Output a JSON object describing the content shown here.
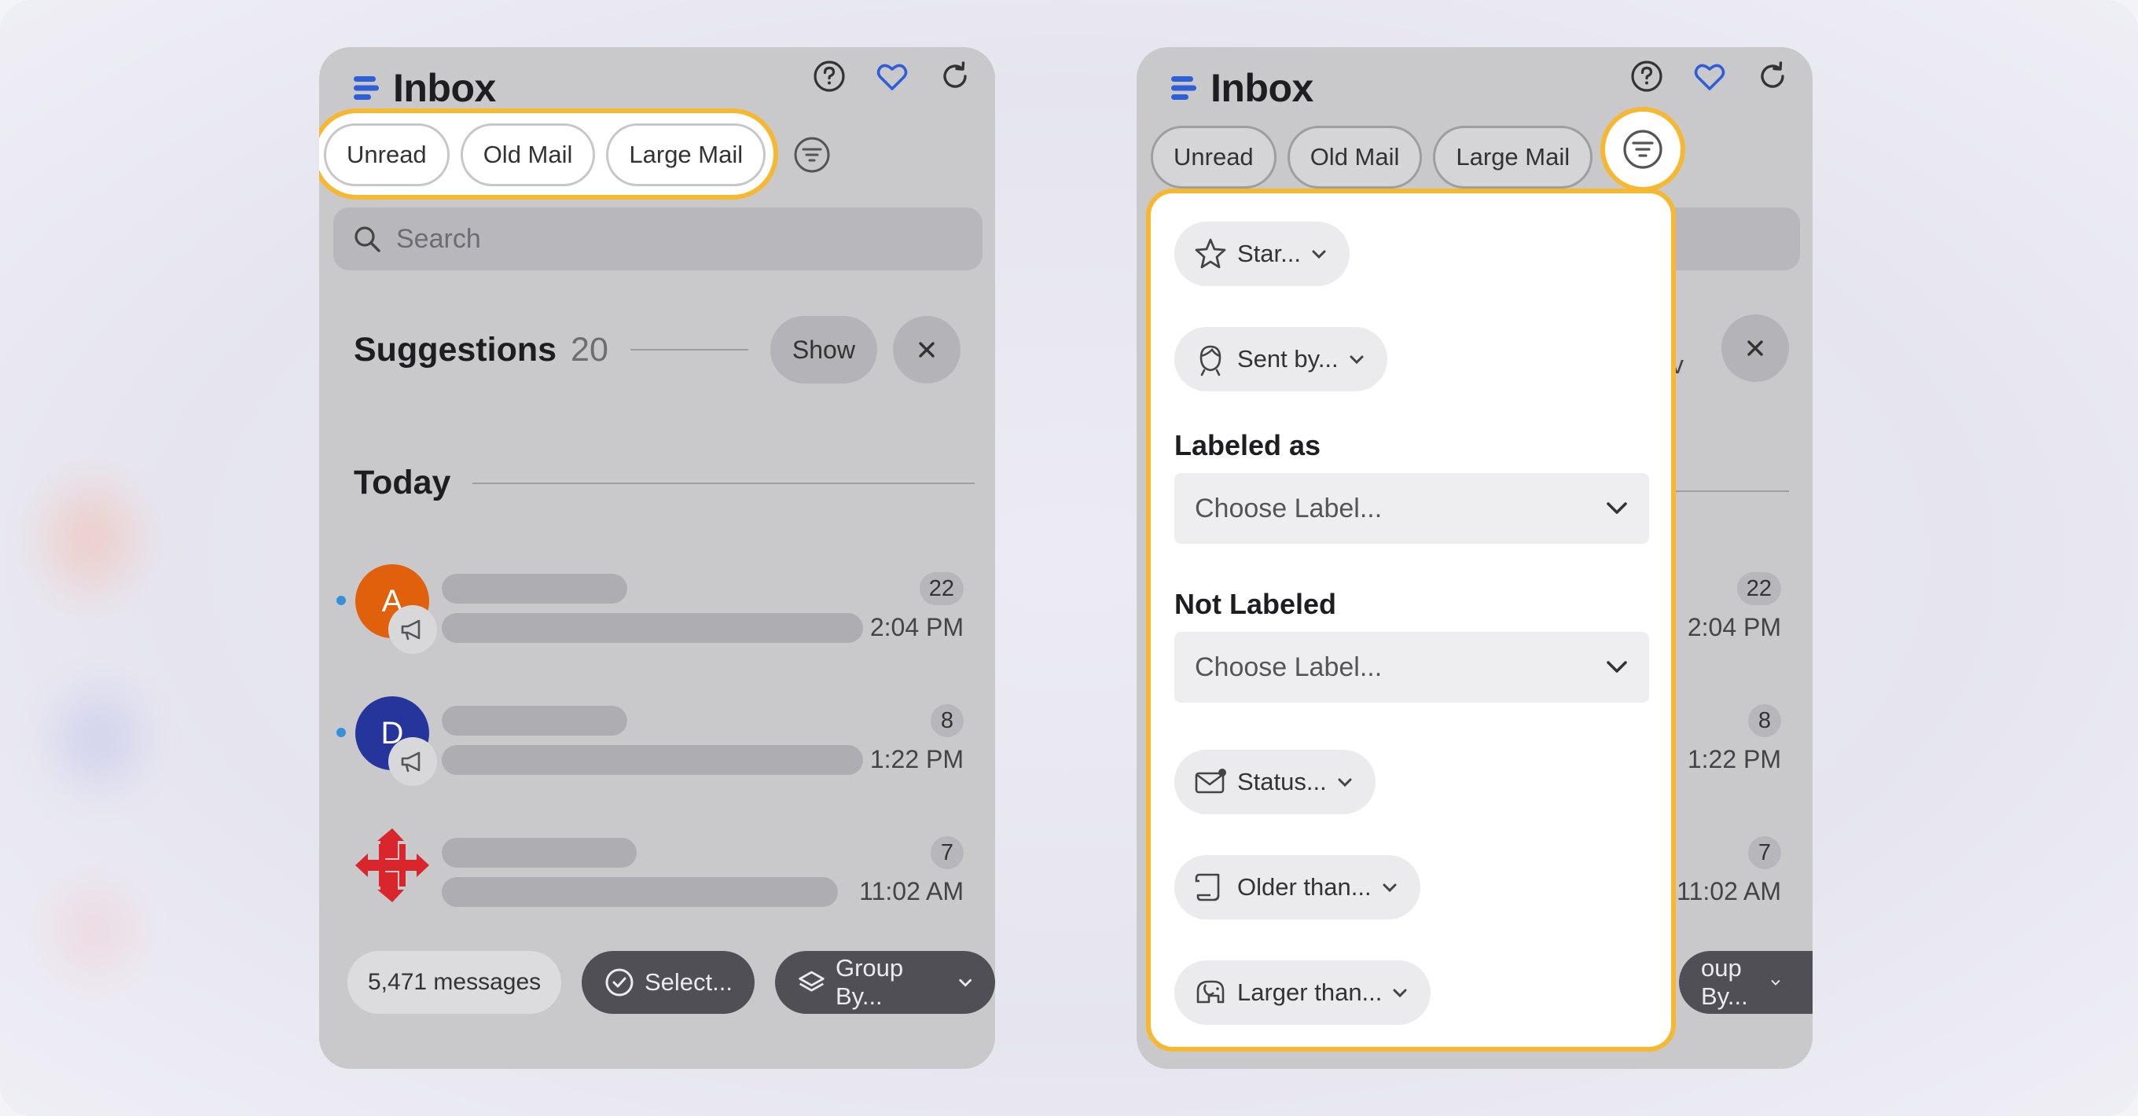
{
  "left_panel": {
    "title": "Inbox",
    "chips": [
      "Unread",
      "Old Mail",
      "Large Mail"
    ],
    "search_placeholder": "Search",
    "suggestions": {
      "title": "Suggestions",
      "count": "20",
      "show_label": "Show"
    },
    "section": "Today",
    "rows": [
      {
        "initial": "A",
        "avatar_color": "#e0600c",
        "count": "22",
        "time": "2:04 PM",
        "unread": true
      },
      {
        "initial": "D",
        "avatar_color": "#26359c",
        "count": "8",
        "time": "1:22 PM",
        "unread": true
      },
      {
        "initial": "",
        "avatar_color": "#d8262c",
        "count": "7",
        "time": "11:02 AM",
        "unread": false
      }
    ],
    "bottom": {
      "messages": "5,471 messages",
      "select": "Select...",
      "group_by": "Group By..."
    }
  },
  "right_panel": {
    "title": "Inbox",
    "chips": [
      "Unread",
      "Old Mail",
      "Large Mail"
    ],
    "counts": [
      "22",
      "8",
      "7"
    ],
    "times": [
      "2:04 PM",
      "1:22 PM",
      "11:02 AM"
    ],
    "show_partial": "v",
    "group_by_partial": "oup By..."
  },
  "filter_menu": {
    "star": "Star...",
    "sent_by": "Sent by...",
    "labeled_as": "Labeled as",
    "labeled_placeholder": "Choose Label...",
    "not_labeled": "Not Labeled",
    "not_labeled_placeholder": "Choose Label...",
    "status": "Status...",
    "older_than": "Older than...",
    "larger_than": "Larger than..."
  },
  "colors": {
    "highlight": "#f6b731",
    "accent_blue": "#2f5fd6",
    "unread_dot": "#3a8fd9"
  }
}
